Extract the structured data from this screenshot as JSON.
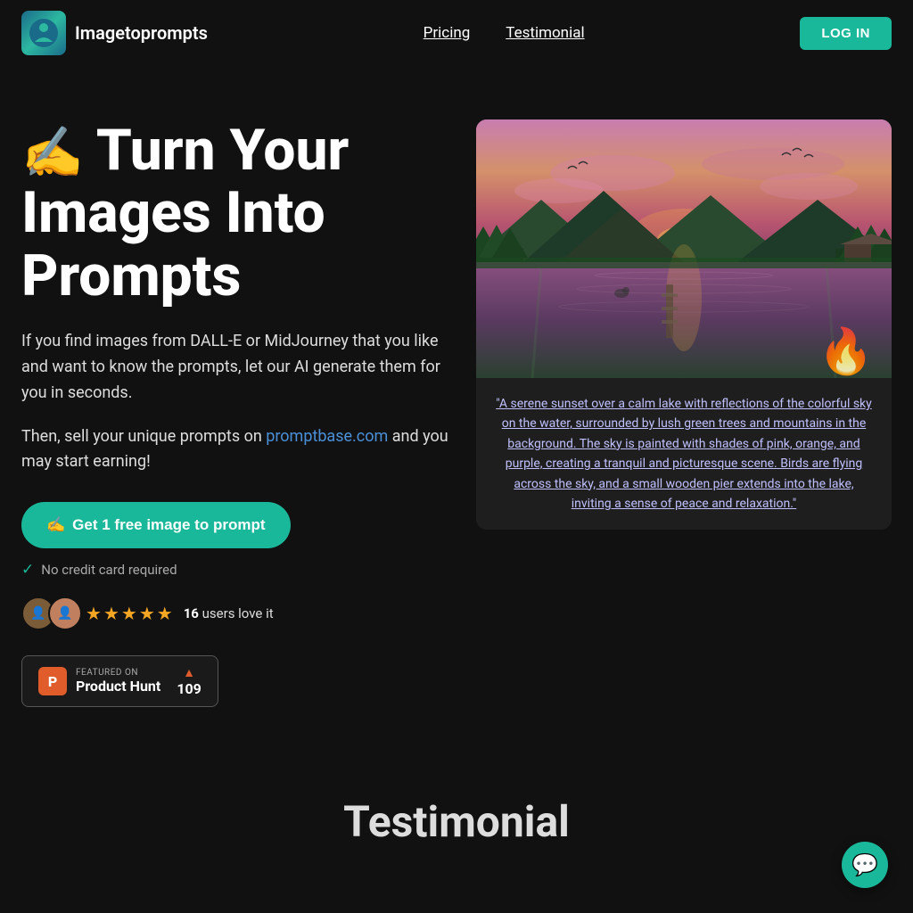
{
  "nav": {
    "logo_text": "Imagetoprompts",
    "links": [
      {
        "label": "Pricing",
        "id": "pricing"
      },
      {
        "label": "Testimonial",
        "id": "testimonial"
      }
    ],
    "login_label": "LOG IN"
  },
  "hero": {
    "title_icon": "✍️",
    "title_line1": "Turn Your",
    "title_line2": "Images Into",
    "title_line3": "Prompts",
    "desc1": "If you find images from DALL-E or MidJourney that you like and want to know the prompts, let our AI generate them for you in seconds.",
    "desc2_prefix": "Then, sell your unique prompts on ",
    "desc2_link_text": "promptbase.com",
    "desc2_link_href": "https://promptbase.com",
    "desc2_suffix": " and you may start earning!",
    "cta_icon": "✍️",
    "cta_label": "Get 1 free image to prompt",
    "no_cc_label": "No credit card required",
    "users_count": "16",
    "users_label": "users love it",
    "product_hunt": {
      "featured_label": "FEATURED ON",
      "name": "Product Hunt",
      "count": "109"
    }
  },
  "image_card": {
    "prompt_text": "\"A serene sunset over a calm lake with reflections of the colorful sky on the water, surrounded by lush green trees and mountains in the background. The sky is painted with shades of pink, orange, and purple, creating a tranquil and picturesque scene. Birds are flying across the sky, and a small wooden pier extends into the lake, inviting a sense of peace and relaxation.\""
  },
  "testimonial": {
    "title": "Testimonial"
  },
  "stars": [
    "★",
    "★",
    "★",
    "★",
    "★"
  ]
}
